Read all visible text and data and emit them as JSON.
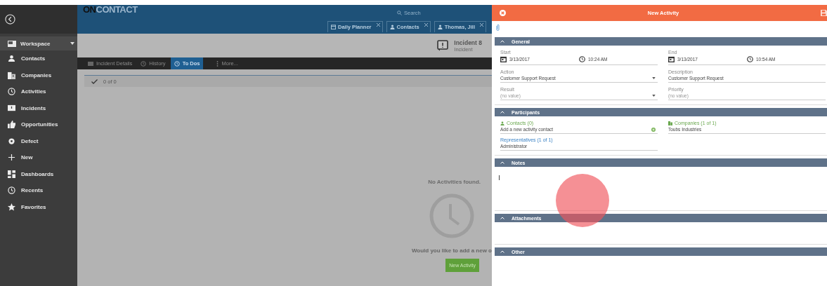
{
  "sidebar": {
    "header": {
      "label": "Workspace"
    },
    "items": [
      {
        "label": "Contacts"
      },
      {
        "label": "Companies"
      },
      {
        "label": "Activities"
      },
      {
        "label": "Incidents"
      },
      {
        "label": "Opportunities"
      },
      {
        "label": "Defect"
      },
      {
        "label": "New"
      },
      {
        "label": "Dashboards"
      },
      {
        "label": "Recents"
      },
      {
        "label": "Favorites"
      }
    ]
  },
  "header": {
    "logo": {
      "prefix": "ON",
      "name": "CONTACT"
    },
    "search": {
      "placeholder": "Search"
    },
    "tabs": [
      {
        "label": "Daily Planner"
      },
      {
        "label": "Contacts"
      },
      {
        "label": "Thomas, Jill"
      }
    ]
  },
  "record": {
    "title": "Incident 8",
    "subtitle": "Incident"
  },
  "toolbar": [
    {
      "label": "Incident Details",
      "selected": false
    },
    {
      "label": "History",
      "selected": false
    },
    {
      "label": "To Dos",
      "selected": true
    },
    {
      "label": "More...",
      "selected": false
    }
  ],
  "list": {
    "count": "0 of 0",
    "empty_message": "No Activities found.",
    "prompt": "Would you like to add a new o",
    "button": "New Activity"
  },
  "panel": {
    "title": "New Activity",
    "general": {
      "title": "General",
      "start": {
        "label": "Start",
        "date": "3/13/2017",
        "time": "10:24 AM"
      },
      "end": {
        "label": "End",
        "date": "3/13/2017",
        "time": "10:54 AM"
      },
      "fields": [
        {
          "label": "Action",
          "value": "Customer Support Request",
          "kind": "dropdown"
        },
        {
          "label": "Description",
          "value": "Customer Support Request",
          "kind": "text"
        },
        {
          "label": "Result",
          "placeholder": "(no value)",
          "kind": "dropdown"
        },
        {
          "label": "Priority",
          "placeholder": "(no value)",
          "kind": "text"
        }
      ]
    },
    "participants": {
      "title": "Participants",
      "items": [
        {
          "label": "Contacts (0)",
          "value": "Add a new activity contact",
          "kind": "contact"
        },
        {
          "label": "Companies (1 of 1)",
          "value": "Toubs Industries",
          "kind": "company"
        },
        {
          "label": "Representatives (1 of 1)",
          "value": "Administrator",
          "kind": "representative"
        }
      ]
    },
    "notes": {
      "title": "Notes"
    },
    "attachments": {
      "title": "Attachments"
    },
    "other": {
      "title": "Other"
    }
  }
}
